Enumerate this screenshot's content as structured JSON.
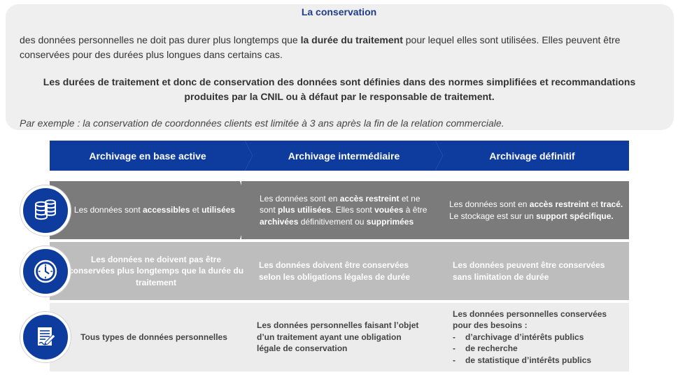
{
  "info": {
    "title": "La conservation",
    "para1_a": "des données personnelles ne doit pas durer plus longtemps que ",
    "para1_b": "la durée du traitement",
    "para1_c": " pour lequel elles sont utilisées. Elles peuvent être conservées pour des durées plus longues dans certains cas.",
    "para2": "Les durées de traitement et donc de conservation des données sont définies dans des normes simplifiées et recommandations produites par la CNIL ou à défaut par le responsable de traitement.",
    "para3": "Par exemple : la conservation de coordonnées clients est limitée à 3 ans après la fin de la relation commerciale."
  },
  "headers": [
    "Archivage en base active",
    "Archivage intermédiaire",
    "Archivage définitif"
  ],
  "row1": {
    "icon": "database-icon",
    "c1": [
      "Les données sont ",
      "accessibles",
      " et ",
      "utilisées"
    ],
    "c2": [
      "Les données sont en ",
      "accès restreint",
      " et ne sont ",
      "plus utilisées",
      ". Elles sont ",
      "vouées",
      " à être ",
      "archivées",
      " définitivement ou ",
      "supprimées"
    ],
    "c3": [
      "Les données sont en ",
      "accès restreint",
      " et ",
      "tracé.",
      " Le stockage est sur un ",
      "support spécifique."
    ]
  },
  "row2": {
    "icon": "clock-icon",
    "c1": "Les données ne doivent pas être conservées plus longtemps que la durée du traitement",
    "c2": "Les données doivent être conservées selon les obligations légales de durée",
    "c3": "Les données peuvent être conservées sans limitation de durée"
  },
  "row3": {
    "icon": "document-sign-icon",
    "c1": "Tous types de données personnelles",
    "c2": "Les données personnelles faisant l’objet d’un traitement ayant une obligation légale de conservation",
    "c3_intro": "Les données personnelles conservées pour des besoins :",
    "c3_items": [
      "d’archivage d’intérêts publics",
      "de recherche",
      "de statistique d’intérêts publics"
    ]
  },
  "colors": {
    "header_blue": "#0d3c9e",
    "row1_gray": "#7b7b7b",
    "row2_gray": "#bdbdbd",
    "row3_gray": "#ececec"
  }
}
